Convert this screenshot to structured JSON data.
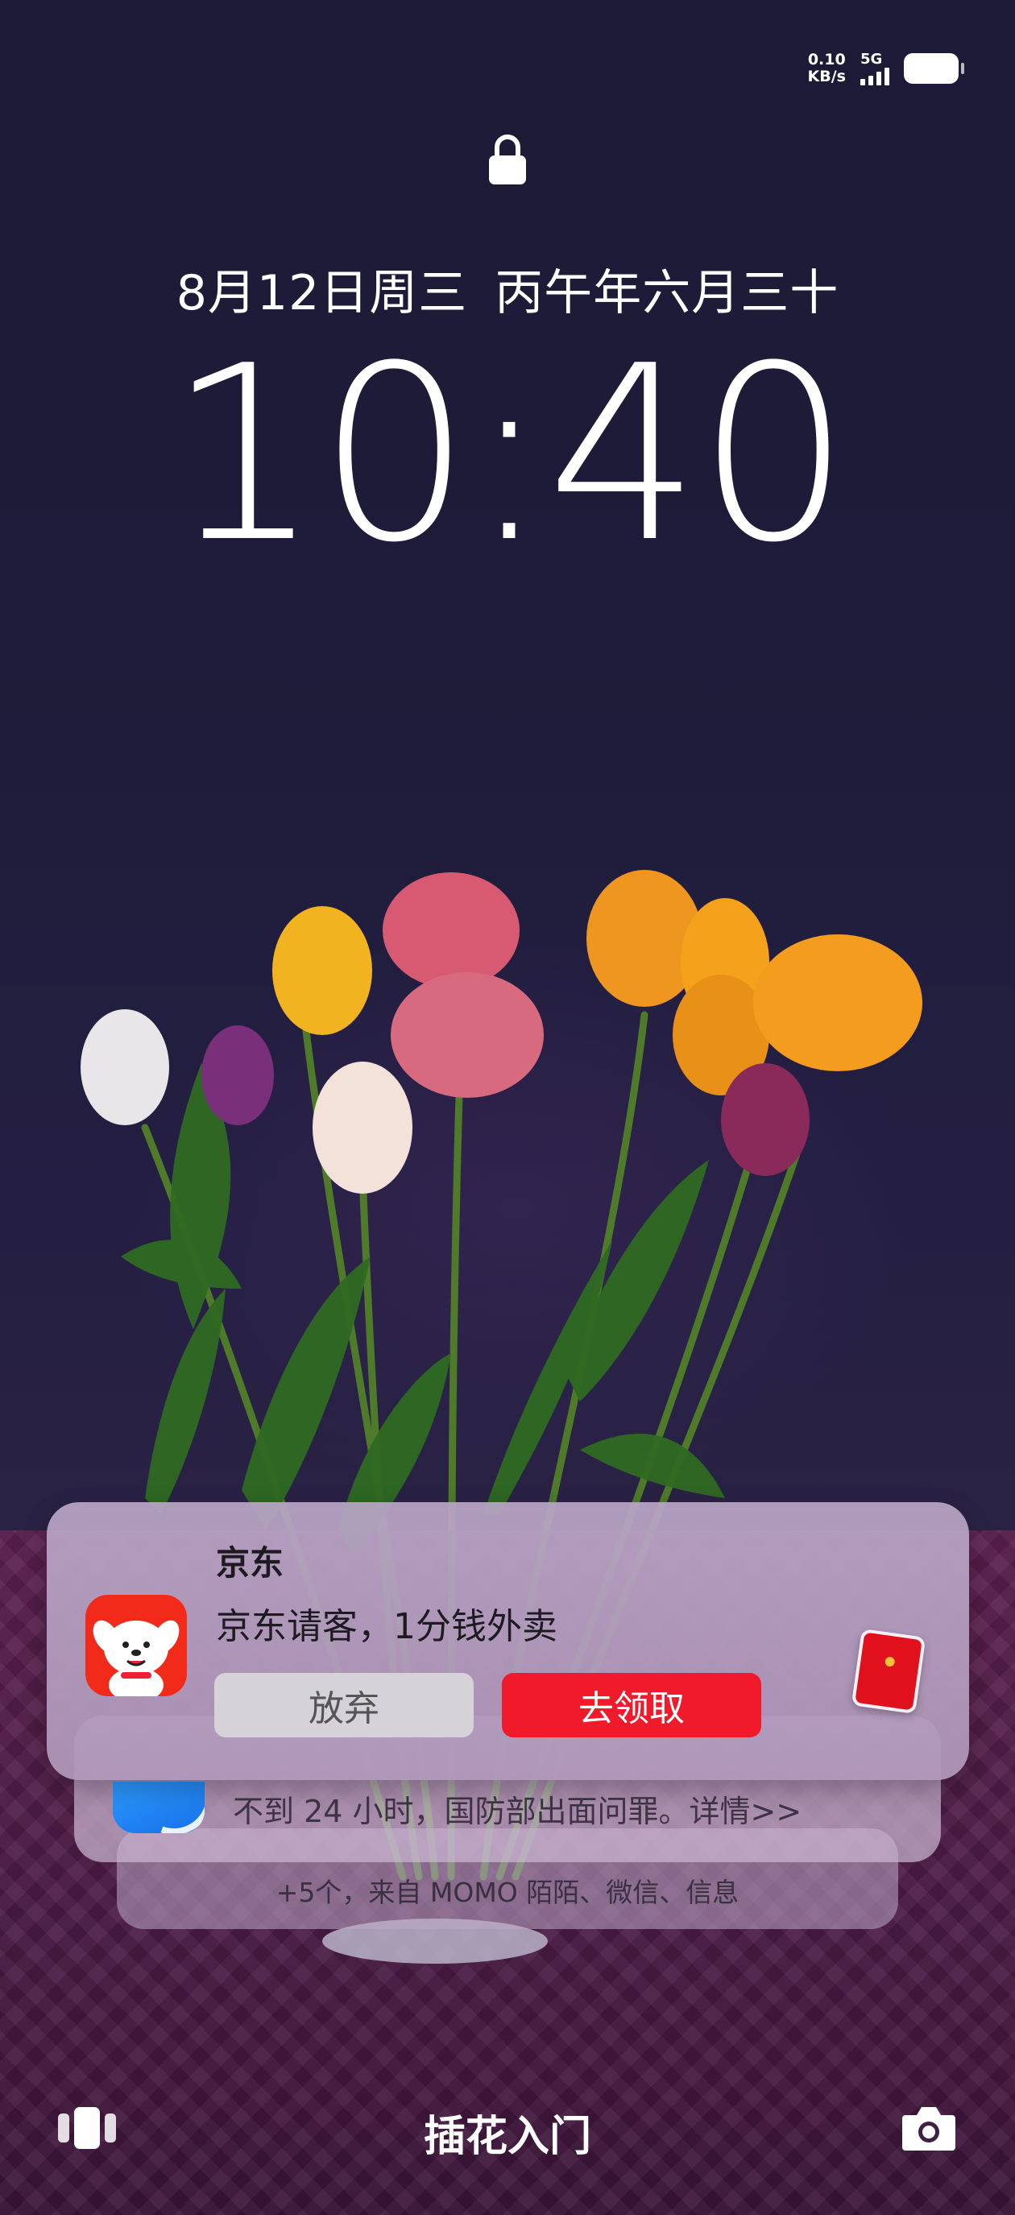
{
  "status_bar": {
    "net_speed_value": "0.10",
    "net_speed_unit": "KB/s",
    "signal_type": "5G",
    "signal_bars": 4,
    "battery_icon": "battery-full-icon"
  },
  "lock_screen": {
    "lock_icon": "lock-icon",
    "date": "8月12日周三",
    "lunar_date": "丙午年六月三十",
    "time": "10:40"
  },
  "notifications": {
    "primary": {
      "app_name": "京东",
      "message": "京东请客，1分钱外卖",
      "dismiss_label": "放弃",
      "claim_label": "去领取",
      "icon": "jd-dog-icon",
      "thumbnail": "red-envelope-icon"
    },
    "secondary": {
      "message": "不到 24 小时，国防部出面问罪。详情>>",
      "icon": "news-app-icon"
    },
    "summary": "+5个，来自 MOMO 陌陌、微信、信息"
  },
  "bottom_bar": {
    "left_icon": "carousel-icon",
    "title": "插花入门",
    "right_icon": "camera-icon"
  },
  "colors": {
    "accent_red": "#f01a2a",
    "jd_red": "#f22a1a",
    "dismiss_gray": "#d5d3d8"
  }
}
